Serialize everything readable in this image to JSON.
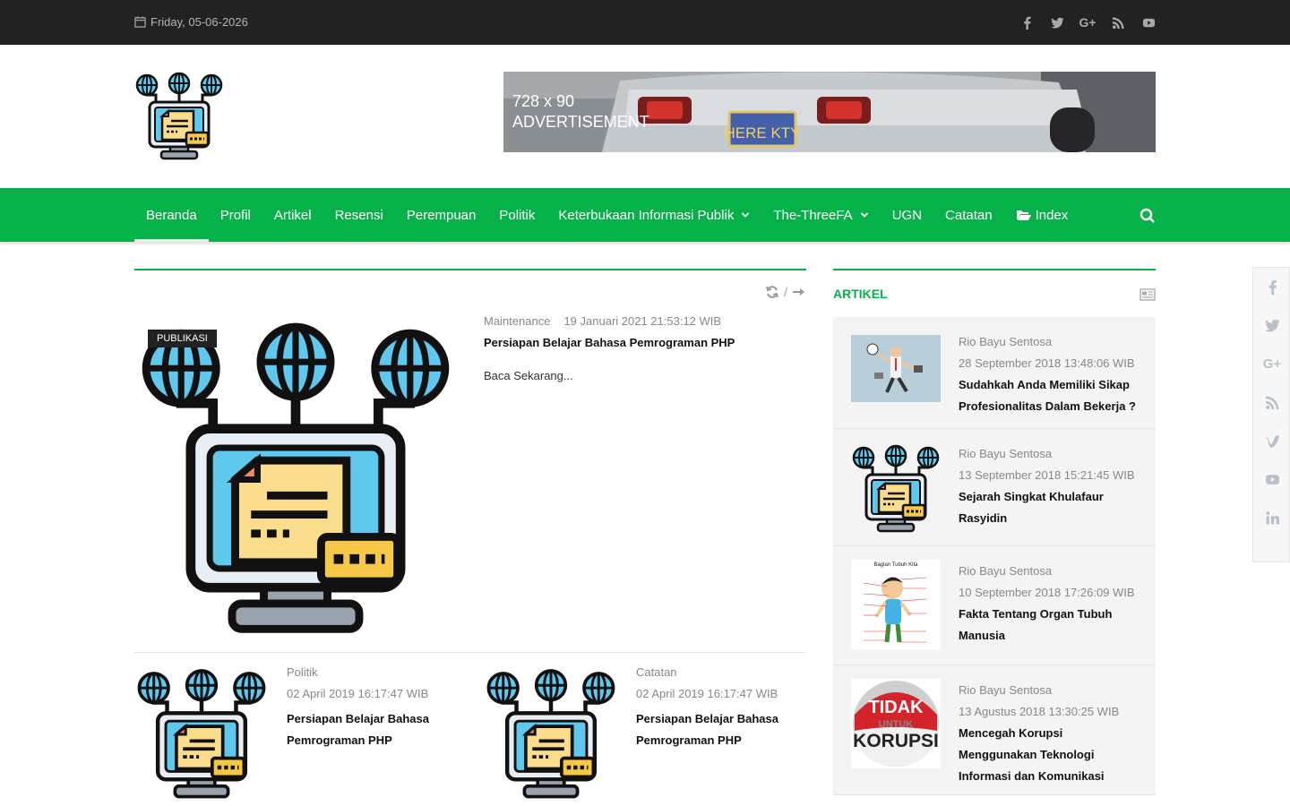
{
  "topbar": {
    "date": "Friday, 05-06-2026",
    "social_icons": [
      "facebook-icon",
      "twitter-icon",
      "google-plus-icon",
      "rss-icon",
      "youtube-icon"
    ]
  },
  "header": {
    "ad_line1": "728 x 90",
    "ad_line2": "ADVERTISEMENT",
    "ad_plate": "HERE KTY"
  },
  "nav": {
    "items": [
      "Beranda",
      "Profil",
      "Artikel",
      "Resensi",
      "Perempuan",
      "Politik",
      "Keterbukaan Informasi Publik",
      "The-ThreeFA",
      "UGN",
      "Catatan",
      "Index"
    ],
    "active": "Beranda",
    "accent": "#07b14a"
  },
  "main": {
    "controls_sep": "/",
    "feature": {
      "badge": "PUBLIKASI",
      "category": "Maintenance",
      "date": "19 Januari 2021 21:53:12 WIB",
      "title": "Persiapan Belajar Bahasa Pemrograman PHP",
      "read_more": "Baca Sekarang..."
    },
    "posts": [
      {
        "category": "Politik",
        "date": "02 April 2019 16:17:47 WIB",
        "title": "Persiapan Belajar Bahasa Pemrograman PHP"
      },
      {
        "category": "Catatan",
        "date": "02 April 2019 16:17:47 WIB",
        "title": "Persiapan Belajar Bahasa Pemrograman PHP"
      }
    ]
  },
  "sidebar": {
    "heading": "ARTIKEL",
    "items": [
      {
        "author": "Rio Bayu Sentosa",
        "date": "28 September 2018 13:48:06 WIB",
        "title": "Sudahkah Anda Memiliki Sikap Profesionalitas Dalam Bekerja ?"
      },
      {
        "author": "Rio Bayu Sentosa",
        "date": "13 September 2018 15:21:45 WIB",
        "title": "Sejarah Singkat Khulafaur Rasyidin"
      },
      {
        "author": "Rio Bayu Sentosa",
        "date": "10 September 2018 17:26:09 WIB",
        "title": "Fakta Tentang Organ Tubuh Manusia",
        "thumb_caption": "Bagian Tubuh Kita"
      },
      {
        "author": "Rio Bayu Sentosa",
        "date": "13 Agustus 2018 13:30:25 WIB",
        "title": "Mencegah Korupsi Menggunakan Teknologi Informasi dan Komunikasi",
        "thumb_text1": "TIDAK",
        "thumb_text2": "UNTUK",
        "thumb_text3": "KORUPSI"
      }
    ]
  },
  "share_bar": {
    "icons": [
      "facebook-icon",
      "twitter-icon",
      "google-plus-icon",
      "rss-icon",
      "vimeo-icon",
      "youtube-icon",
      "linkedin-icon"
    ]
  }
}
